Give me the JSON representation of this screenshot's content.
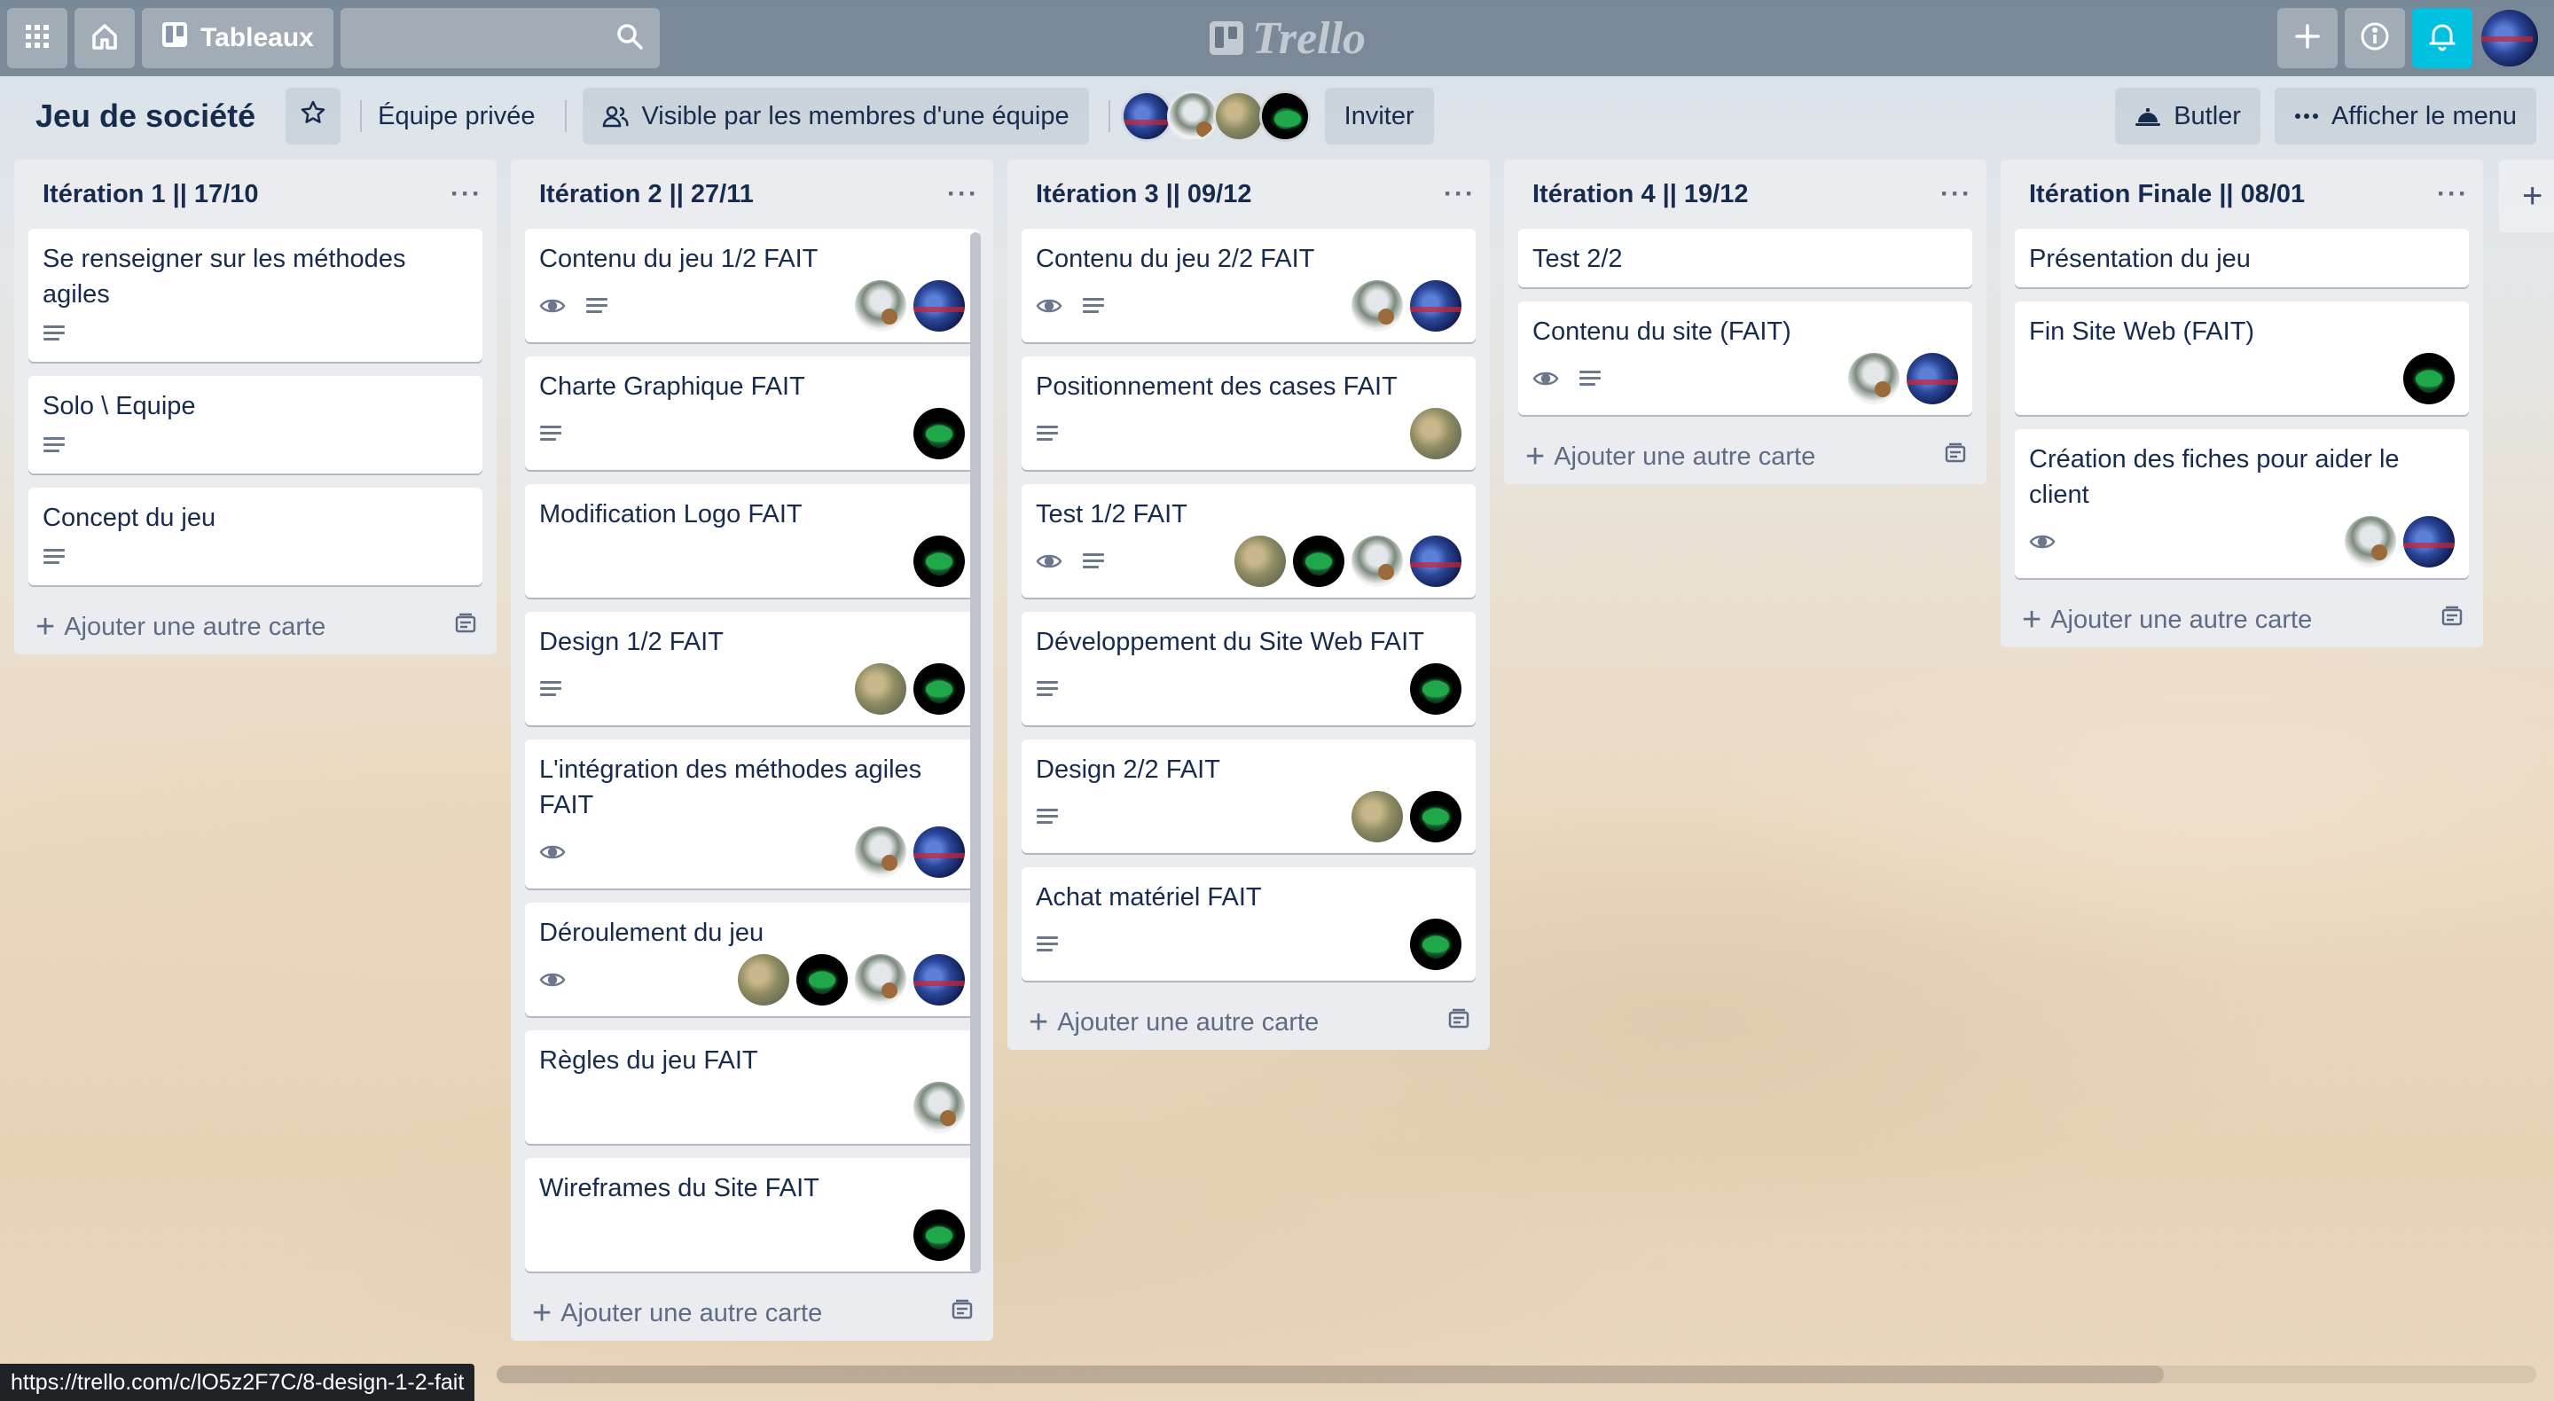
{
  "header": {
    "boards_label": "Tableaux",
    "logo_text": "Trello",
    "search_value": ""
  },
  "board": {
    "title": "Jeu de société",
    "team_label": "Équipe privée",
    "visibility_label": "Visible par les membres d'une équipe",
    "invite_label": "Inviter",
    "butler_label": "Butler",
    "menu_label": "Afficher le menu",
    "member_avatars": [
      "avatar-blue",
      "avatar-robot",
      "avatar-photo",
      "avatar-green"
    ]
  },
  "lists": [
    {
      "title": "Itération 1 || 17/10",
      "add_label": "Ajouter une autre carte",
      "cards": [
        {
          "title": "Se renseigner sur les méthodes agiles",
          "watch": false,
          "description": true,
          "members": []
        },
        {
          "title": "Solo \\ Equipe",
          "watch": false,
          "description": true,
          "members": []
        },
        {
          "title": "Concept du jeu",
          "watch": false,
          "description": true,
          "members": []
        }
      ]
    },
    {
      "title": "Itération 2 || 27/11",
      "add_label": "Ajouter une autre carte",
      "cards": [
        {
          "title": "Contenu du jeu 1/2 FAIT",
          "watch": true,
          "description": true,
          "members": [
            "robot",
            "blue"
          ]
        },
        {
          "title": "Charte Graphique FAIT",
          "watch": false,
          "description": true,
          "members": [
            "green"
          ]
        },
        {
          "title": "Modification Logo FAIT",
          "watch": false,
          "description": false,
          "members": [
            "green"
          ]
        },
        {
          "title": "Design 1/2 FAIT",
          "watch": false,
          "description": true,
          "members": [
            "photo",
            "green"
          ]
        },
        {
          "title": "L'intégration des méthodes agiles FAIT",
          "watch": true,
          "description": false,
          "members": [
            "robot",
            "blue"
          ]
        },
        {
          "title": "Déroulement du jeu",
          "watch": true,
          "description": false,
          "members": [
            "photo",
            "green",
            "robot",
            "blue"
          ]
        },
        {
          "title": "Règles du jeu FAIT",
          "watch": false,
          "description": false,
          "members": [
            "robot"
          ]
        },
        {
          "title": "Wireframes du Site FAIT",
          "watch": false,
          "description": false,
          "members": [
            "green"
          ]
        }
      ]
    },
    {
      "title": "Itération 3 || 09/12",
      "add_label": "Ajouter une autre carte",
      "cards": [
        {
          "title": "Contenu du jeu 2/2 FAIT",
          "watch": true,
          "description": true,
          "members": [
            "robot",
            "blue"
          ]
        },
        {
          "title": "Positionnement des cases FAIT",
          "watch": false,
          "description": true,
          "members": [
            "photo"
          ]
        },
        {
          "title": "Test 1/2 FAIT",
          "watch": true,
          "description": true,
          "members": [
            "photo",
            "green",
            "robot",
            "blue"
          ]
        },
        {
          "title": "Développement du Site Web FAIT",
          "watch": false,
          "description": true,
          "members": [
            "green"
          ]
        },
        {
          "title": "Design 2/2 FAIT",
          "watch": false,
          "description": true,
          "members": [
            "photo",
            "green"
          ]
        },
        {
          "title": "Achat matériel FAIT",
          "watch": false,
          "description": true,
          "members": [
            "green"
          ]
        }
      ]
    },
    {
      "title": "Itération 4 || 19/12",
      "add_label": "Ajouter une autre carte",
      "cards": [
        {
          "title": "Test 2/2",
          "watch": false,
          "description": false,
          "members": []
        },
        {
          "title": "Contenu du site (FAIT)",
          "watch": true,
          "description": true,
          "members": [
            "robot",
            "blue"
          ]
        }
      ]
    },
    {
      "title": "Itération Finale || 08/01",
      "add_label": "Ajouter une autre carte",
      "cards": [
        {
          "title": "Présentation du jeu",
          "watch": false,
          "description": false,
          "members": []
        },
        {
          "title": "Fin Site Web (FAIT)",
          "watch": false,
          "description": false,
          "members": [
            "green"
          ]
        },
        {
          "title": "Création des fiches pour aider le client",
          "watch": true,
          "description": false,
          "members": [
            "robot",
            "blue"
          ]
        }
      ]
    }
  ],
  "status_url": "https://trello.com/c/lO5z2F7C/8-design-1-2-fait",
  "colors": {
    "header_bg": "#5f6e80",
    "list_bg": "#ebecf0",
    "notify": "#00c2e0",
    "text": "#172b4d"
  }
}
